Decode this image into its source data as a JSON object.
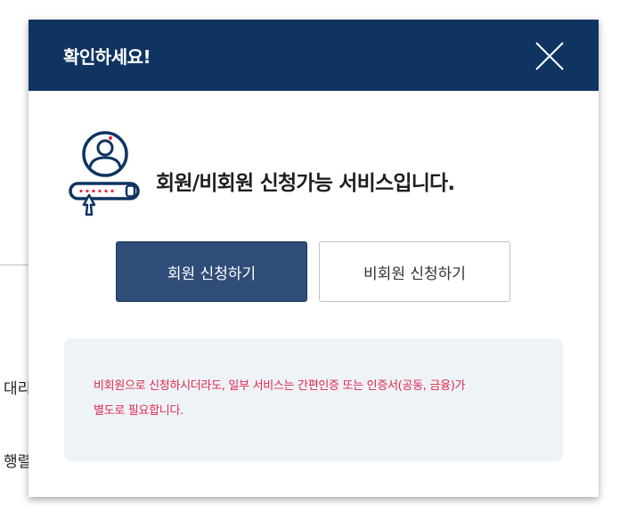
{
  "background": {
    "line1": "대리",
    "line2": "행렬"
  },
  "modal": {
    "title": "확인하세요!",
    "close_icon": "close-icon",
    "hero_icon": "user-login-icon",
    "hero_text": "회원/비회원 신청가능 서비스입니다.",
    "buttons": {
      "member": "회원 신청하기",
      "nonmember": "비회원 신청하기"
    },
    "notice": {
      "line1": "비회원으로 신청하시더라도, 일부 서비스는 간편인증 또는 인증서(공동, 금융)가",
      "line2": "별도로 필요합니다."
    }
  },
  "colors": {
    "header": "#0f3462",
    "primary_button": "#304c78",
    "notice_bg": "#eef3f8",
    "notice_text": "#e0284d"
  }
}
